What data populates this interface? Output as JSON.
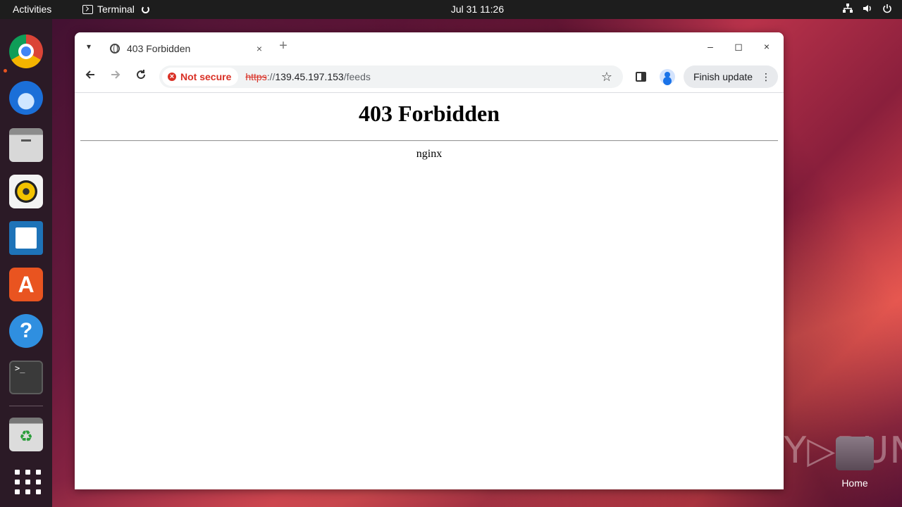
{
  "topbar": {
    "activities": "Activities",
    "app_name": "Terminal",
    "clock": "Jul 31  11:26"
  },
  "dock": {
    "items": [
      "chrome-icon",
      "thunderbird-icon",
      "files-icon",
      "rhythmbox-icon",
      "writer-icon",
      "app-center-icon",
      "help-icon",
      "terminal-icon",
      "trash-icon",
      "show-apps-icon"
    ]
  },
  "browser": {
    "tab": {
      "title": "403 Forbidden",
      "close": "×"
    },
    "new_tab": "+",
    "window_controls": {
      "minimize": "–",
      "maximize": "◻",
      "close": "×"
    },
    "security_label": "Not secure",
    "url": {
      "scheme": "https",
      "separator": "://",
      "host": "139.45.197.153",
      "path": "/feeds"
    },
    "finish_update": "Finish update",
    "kebab": "⋮"
  },
  "page": {
    "heading": "403 Forbidden",
    "server": "nginx"
  },
  "desktop": {
    "watermark": "ANY▷RUN",
    "home_label": "Home"
  },
  "colors": {
    "security_red": "#d93025",
    "accent_orange": "#e95420"
  }
}
